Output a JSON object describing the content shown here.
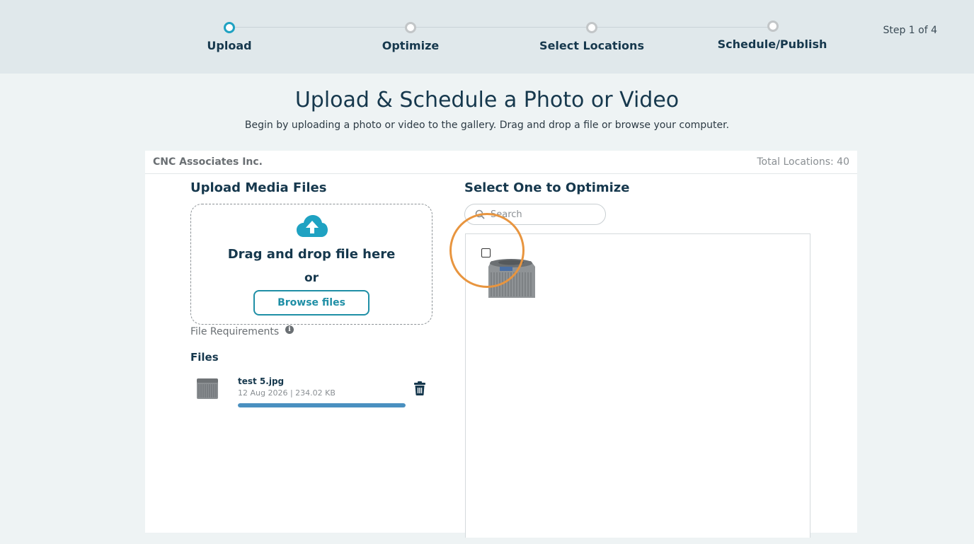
{
  "stepper": {
    "steps": [
      {
        "label": "Upload",
        "active": true
      },
      {
        "label": "Optimize",
        "active": false
      },
      {
        "label": "Select Locations",
        "active": false
      },
      {
        "label": "Schedule/Publish",
        "active": false
      }
    ],
    "step_count": "Step 1 of 4",
    "active_color": "#1fa2c2"
  },
  "header": {
    "title": "Upload & Schedule a Photo or Video",
    "subtitle": "Begin by uploading a photo or video to the gallery. Drag and drop a file or browse your computer."
  },
  "panel": {
    "company": "CNC Associates Inc.",
    "locations": "Total Locations: 40"
  },
  "upload": {
    "title": "Upload Media Files",
    "drag_text": "Drag and drop file here",
    "or_text": "or",
    "browse_label": "Browse files",
    "file_requirements": "File Requirements",
    "icon": "cloud-upload-icon"
  },
  "files": {
    "title": "Files",
    "items": [
      {
        "name": "test 5.jpg",
        "meta": "12 Aug 2026 |  234.02 KB",
        "progress_percent": 100
      }
    ]
  },
  "optimize": {
    "title": "Select One to Optimize",
    "search_placeholder": "Search"
  },
  "colors": {
    "brand_dark": "#16384d",
    "accent_teal": "#1f8fa6",
    "progress": "#4a90c0",
    "highlight": "#e8953f"
  }
}
